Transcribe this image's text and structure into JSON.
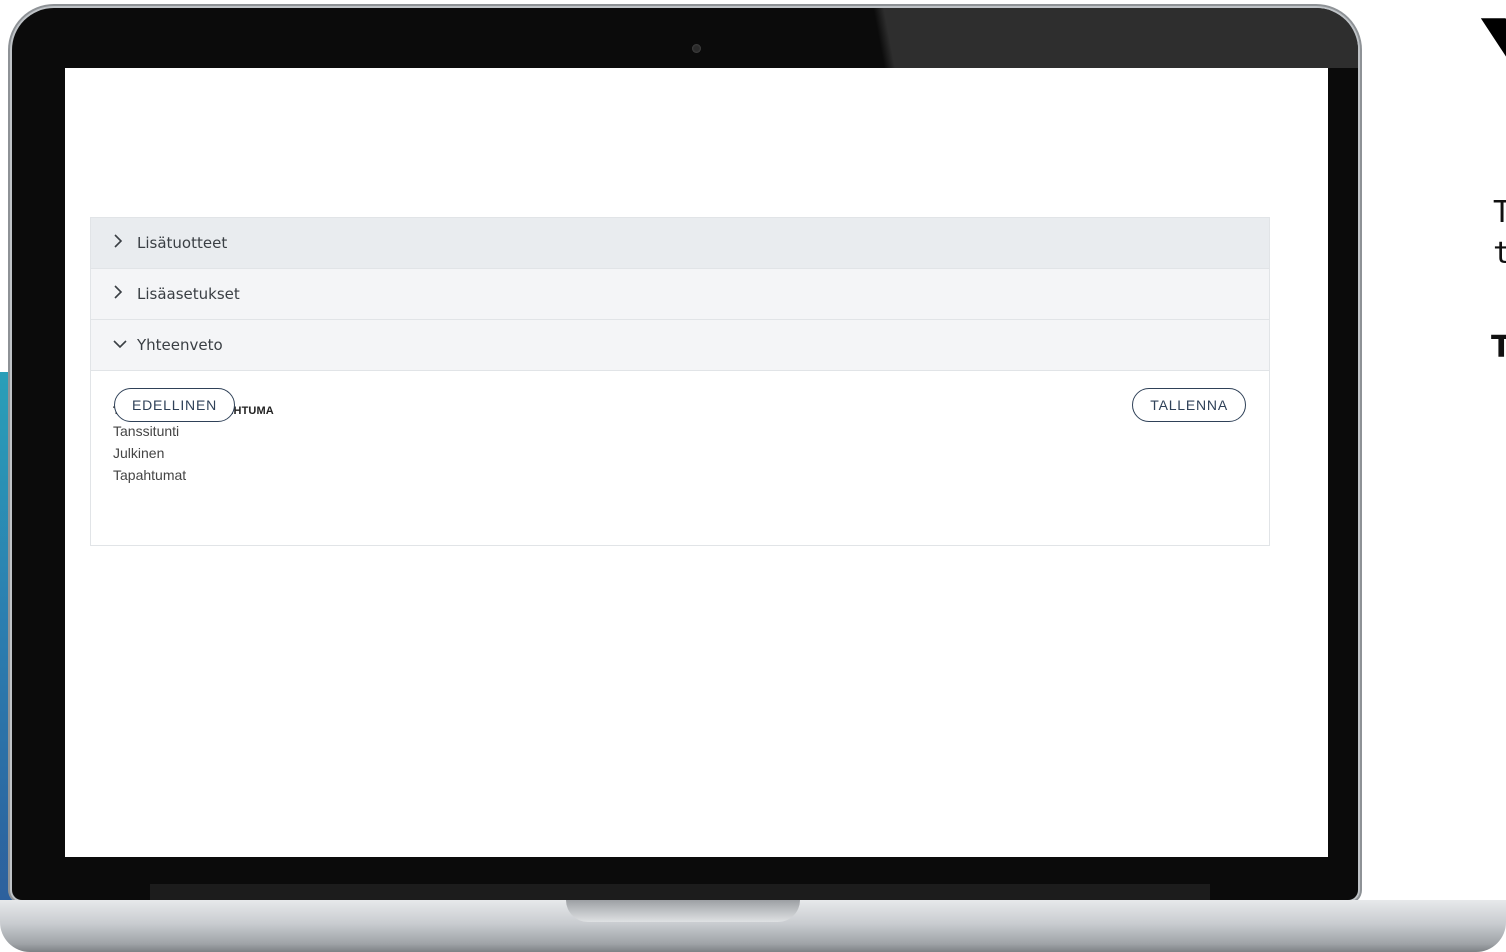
{
  "accordion": {
    "sections": [
      {
        "label": "Lisätuotteet",
        "chevron": "chevron-right-icon"
      },
      {
        "label": "Lisäasetukset",
        "chevron": "chevron-right-icon"
      },
      {
        "label": "Yhteenveto",
        "chevron": "chevron-down-icon"
      }
    ]
  },
  "summary": {
    "title": "TALLENNA UUSI TAPAHTUMA",
    "lines": [
      "Tanssitunti",
      "Julkinen",
      "Tapahtumat"
    ]
  },
  "buttons": {
    "previous": "EDELLINEN",
    "save": "TALLENNA"
  },
  "right_edge": {
    "big": "Y",
    "line1": "T",
    "line2": "t",
    "line3": "T"
  }
}
